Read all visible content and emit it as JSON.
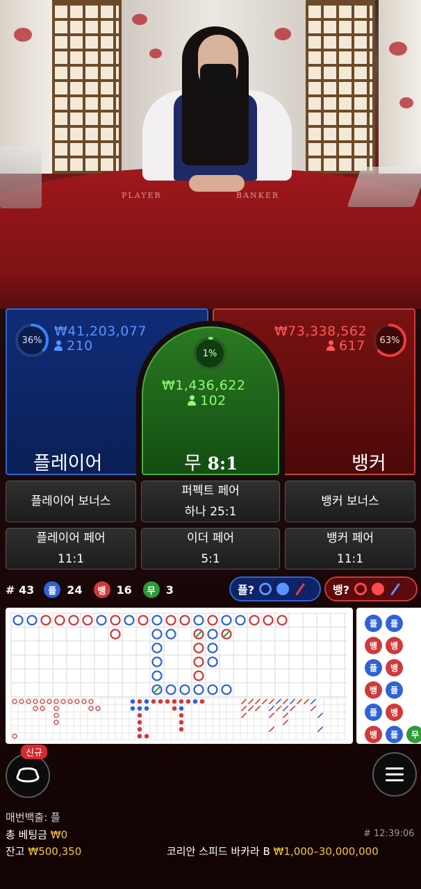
{
  "table": {
    "felt_player": "PLAYER",
    "felt_banker": "BANKER"
  },
  "bets": {
    "player": {
      "percent": "36%",
      "percent_value": 36,
      "amount": "₩41,203,077",
      "players": "210",
      "title": "플레이어",
      "color": "#2f63d6"
    },
    "tie": {
      "percent": "1%",
      "percent_value": 1,
      "amount": "₩1,436,622",
      "players": "102",
      "title": "무",
      "payout": "8:1",
      "color": "#46b13f"
    },
    "banker": {
      "percent": "63%",
      "percent_value": 63,
      "amount": "₩73,338,562",
      "players": "617",
      "title": "뱅커",
      "color": "#d13a3a"
    }
  },
  "side_bets": [
    {
      "label": "플레이어 보너스",
      "payout": ""
    },
    {
      "label": "퍼펙트 페어",
      "payout": "하나 25:1"
    },
    {
      "label": "뱅커 보너스",
      "payout": ""
    },
    {
      "label": "플레이어 페어",
      "payout": "11:1"
    },
    {
      "label": "이더 페어",
      "payout": "5:1"
    },
    {
      "label": "뱅커 페어",
      "payout": "11:1"
    }
  ],
  "stats": {
    "round": "# 43",
    "player_label": "플",
    "player_count": "24",
    "banker_label": "뱅",
    "banker_count": "16",
    "tie_label": "무",
    "tie_count": "3"
  },
  "predictions": {
    "player": "플?",
    "banker": "뱅?"
  },
  "bead_road": [
    [
      "플",
      "뱅",
      "플",
      "뱅",
      "플",
      "뱅"
    ],
    [
      "플",
      "뱅",
      "뱅",
      "플",
      "뱅",
      "플"
    ],
    [
      "",
      "",
      "",
      "",
      "",
      "무"
    ]
  ],
  "controls": {
    "new_badge": "신규"
  },
  "footer": {
    "last_result_label": "매번백출:",
    "last_result_value": "플",
    "total_bet_label": "총 베팅금",
    "total_bet_value": "₩0",
    "balance_label": "잔고",
    "balance_value": "₩500,350",
    "round_id": "# 12:39:06",
    "table_name": "코리안 스피드 바카라 B",
    "limits": "₩1,000–30,000,000"
  },
  "colors": {
    "player": "#2f63d6",
    "banker": "#d13a3a",
    "tie": "#2e9a3a",
    "accent_yellow": "#f4c53b"
  }
}
